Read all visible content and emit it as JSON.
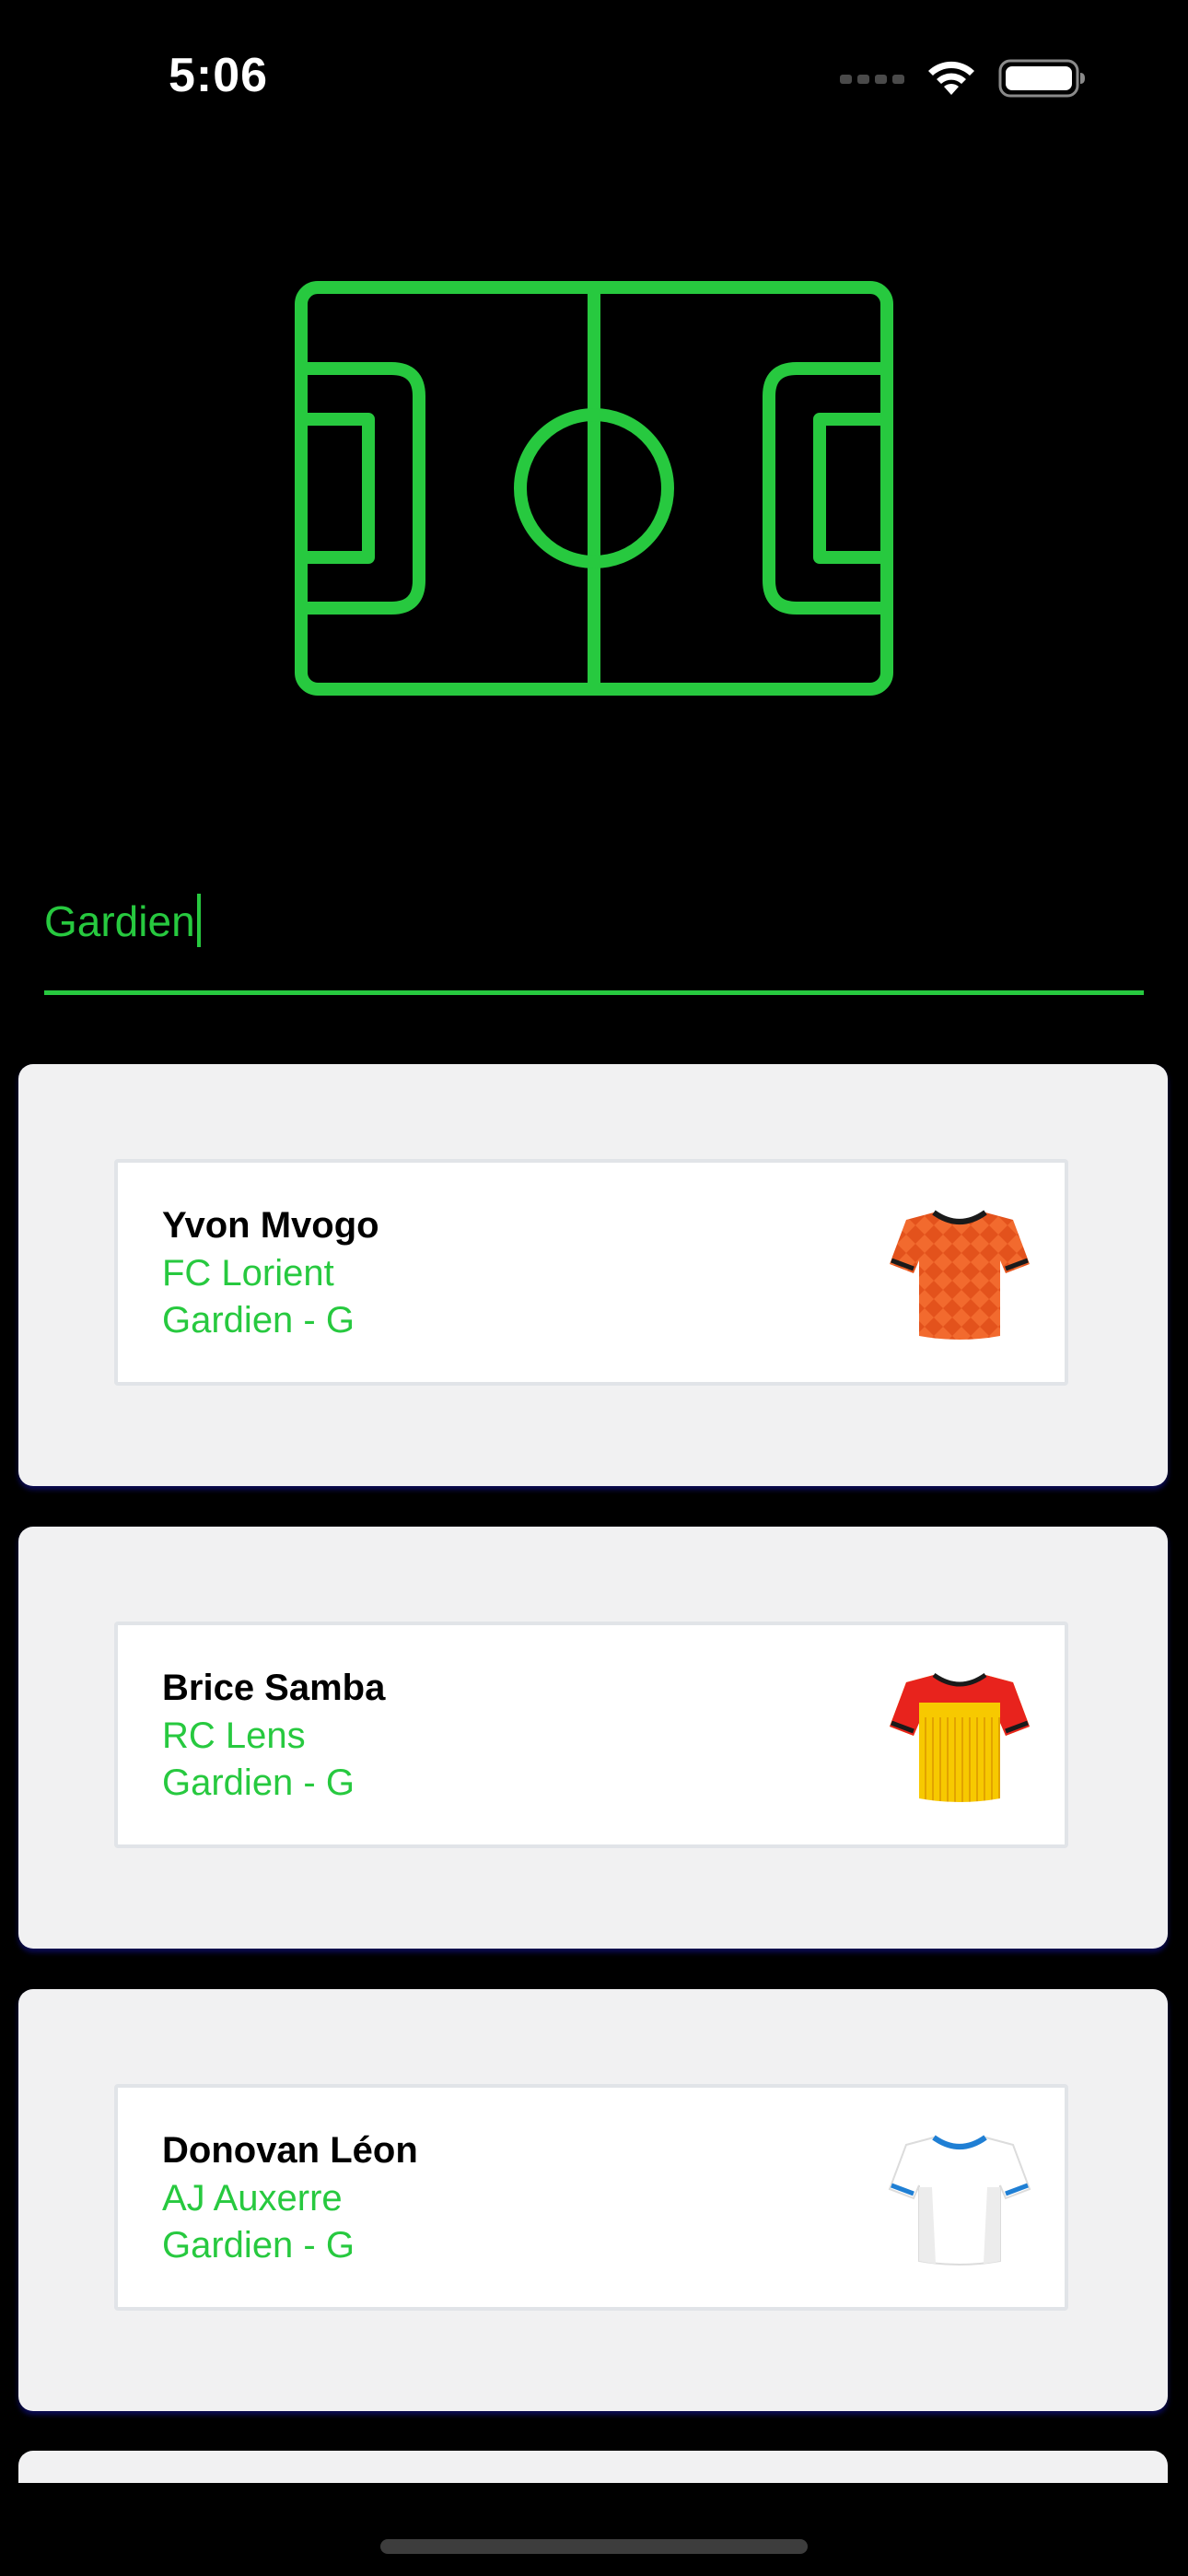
{
  "status_bar": {
    "time": "5:06",
    "icons": [
      "cellular-dots-icon",
      "wifi-icon",
      "battery-icon"
    ]
  },
  "logo": {
    "icon": "football-pitch-icon",
    "color": "#27c93f"
  },
  "search": {
    "value": "Gardien",
    "accent_color": "#27c93f"
  },
  "players": [
    {
      "name": "Yvon Mvogo",
      "club": "FC Lorient",
      "position": "Gardien - G",
      "jersey_icon": "orange-jersey-icon",
      "jersey_color": "#f26a2e"
    },
    {
      "name": "Brice Samba",
      "club": "RC Lens",
      "position": "Gardien - G",
      "jersey_icon": "red-yellow-jersey-icon",
      "jersey_color": "#f7c900"
    },
    {
      "name": "Donovan Léon",
      "club": "AJ Auxerre",
      "position": "Gardien - G",
      "jersey_icon": "white-blue-jersey-icon",
      "jersey_color": "#ffffff"
    }
  ],
  "colors": {
    "background": "#000000",
    "accent": "#27c93f",
    "card_background": "#f1f1f2",
    "text_primary": "#000000"
  }
}
